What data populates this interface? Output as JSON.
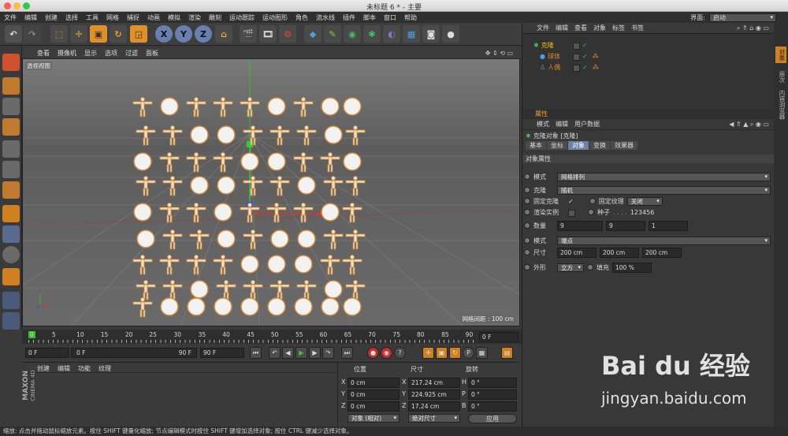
{
  "window": {
    "title": "未标题 6 * - 主要"
  },
  "menubar": {
    "items": [
      "文件",
      "编辑",
      "创建",
      "选择",
      "工具",
      "网格",
      "捕捉",
      "动画",
      "模拟",
      "渲染",
      "雕刻",
      "运动跟踪",
      "运动图形",
      "角色",
      "流水线",
      "插件",
      "脚本",
      "窗口",
      "帮助"
    ],
    "layout_label": "界面:",
    "layout_value": "启动"
  },
  "toolbar": {
    "axis_labels": [
      "X",
      "Y",
      "Z"
    ]
  },
  "viewport": {
    "menu": [
      "查看",
      "摄像机",
      "显示",
      "选项",
      "过滤",
      "面板"
    ],
    "label": "透视视图",
    "grid_spacing": "网格间距 : 100 cm"
  },
  "timeline": {
    "ticks": [
      "0",
      "5",
      "10",
      "15",
      "20",
      "25",
      "30",
      "35",
      "40",
      "45",
      "50",
      "55",
      "60",
      "65",
      "70",
      "75",
      "80",
      "85",
      "90"
    ],
    "end_frame": "0 F"
  },
  "playback": {
    "current": "0 F",
    "range_start": "0 F",
    "range_end": "90 F",
    "max": "90 F"
  },
  "materials": {
    "menu": [
      "创建",
      "编辑",
      "功能",
      "纹理"
    ]
  },
  "coords": {
    "headers": {
      "pos": "位置",
      "size": "尺寸",
      "rot": "旋转"
    },
    "rows": [
      {
        "axis": "X",
        "pos": "0 cm",
        "size_axis": "X",
        "size": "217.24 cm",
        "rot_axis": "H",
        "rot": "0 °"
      },
      {
        "axis": "Y",
        "pos": "0 cm",
        "size_axis": "Y",
        "size": "224.925 cm",
        "rot_axis": "P",
        "rot": "0 °"
      },
      {
        "axis": "Z",
        "pos": "0 cm",
        "size_axis": "Z",
        "size": "17.24 cm",
        "rot_axis": "B",
        "rot": "0 °"
      }
    ],
    "mode": "对象 (相对)",
    "size_mode": "绝对尺寸",
    "apply": "应用"
  },
  "objects": {
    "menu": [
      "文件",
      "编辑",
      "查看",
      "对象",
      "标签",
      "书签"
    ],
    "items": [
      {
        "name": "克隆",
        "color": "#f0c000"
      },
      {
        "name": "球体",
        "color": "#e08a2a"
      },
      {
        "name": "人偶",
        "color": "#e08a2a"
      }
    ]
  },
  "attributes": {
    "title": "属性",
    "menu": [
      "模式",
      "编辑",
      "用户数据"
    ],
    "object_title": "克隆对象 [克隆]",
    "tabs": [
      "基本",
      "坐标",
      "对象",
      "变换",
      "效果器"
    ],
    "active_tab": "对象",
    "section": "对象属性",
    "mode_label": "模式",
    "mode_value": "网格排列",
    "clone_label": "克隆",
    "clone_value": "随机",
    "fix_clone": "固定克隆",
    "fix_texture": "固定纹理",
    "fix_texture_value": "关闭",
    "render_instance": "渲染实例",
    "seed_label": "种子",
    "seed_value": "123456",
    "count_label": "数量",
    "count": [
      "9",
      "9",
      "1"
    ],
    "mode2_label": "模式",
    "mode2_value": "端点",
    "size_label": "尺寸",
    "size": [
      "200 cm",
      "200 cm",
      "200 cm"
    ],
    "shape_label": "外形",
    "shape_value": "立方",
    "fill_label": "填充",
    "fill_value": "100 %"
  },
  "sidetabs": [
    "对象",
    "层次",
    "内容浏览器"
  ],
  "statusbar": {
    "text": "缩放: 点击并拖动鼠标缩放元素。按住 SHIFT 键量化缩放; 节点编辑模式时按住 SHIFT 键增加选择对象; 按住 CTRL 键减少选择对象。"
  },
  "watermark": {
    "line1": "Bai du 经验",
    "line2": "jingyan.baidu.com"
  },
  "brand": {
    "line1": "MAXON",
    "line2": "CINEMA 4D"
  },
  "colors": {
    "accent": "#f0a030",
    "active_tab": "#6a82a8",
    "axis_x": "#e03030",
    "axis_y": "#30d030",
    "axis_z": "#3050e0"
  }
}
